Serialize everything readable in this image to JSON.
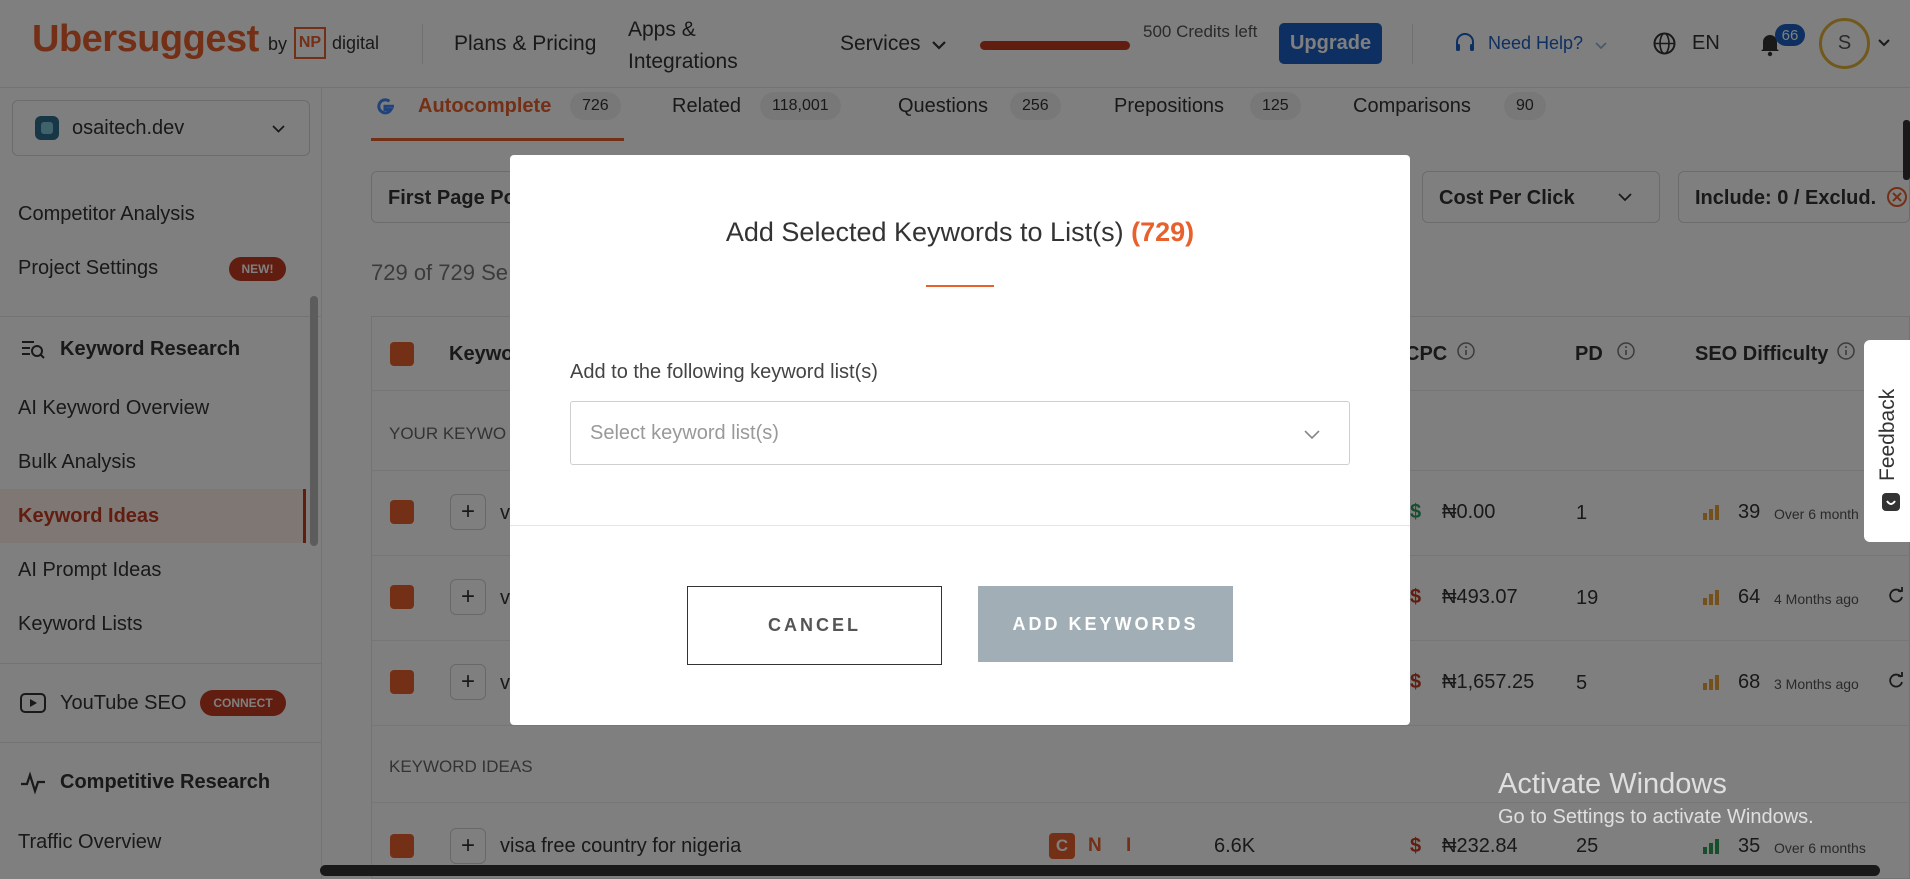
{
  "header": {
    "logo": "Ubersuggest",
    "logo_by": "by",
    "np": "NP",
    "digital": "digital",
    "plans": "Plans & Pricing",
    "apps": "Apps & Integrations",
    "services": "Services",
    "credits": "500 Credits left",
    "upgrade": "Upgrade",
    "help": "Need Help?",
    "lang": "EN",
    "notifications": "66",
    "avatar": "S"
  },
  "sidebar": {
    "project": "osaitech.dev",
    "competitor_analysis": "Competitor Analysis",
    "project_settings": "Project Settings",
    "new_badge": "NEW!",
    "keyword_research": "Keyword Research",
    "ai_keyword_overview": "AI Keyword Overview",
    "bulk_analysis": "Bulk Analysis",
    "keyword_ideas": "Keyword Ideas",
    "ai_prompt_ideas": "AI Prompt Ideas",
    "keyword_lists": "Keyword Lists",
    "youtube_seo": "YouTube SEO",
    "connect_badge": "CONNECT",
    "competitive_research": "Competitive Research",
    "traffic_overview": "Traffic Overview"
  },
  "tabs": [
    {
      "label": "Autocomplete",
      "count": "726"
    },
    {
      "label": "Related",
      "count": "118,001"
    },
    {
      "label": "Questions",
      "count": "256"
    },
    {
      "label": "Prepositions",
      "count": "125"
    },
    {
      "label": "Comparisons",
      "count": "90"
    }
  ],
  "filters": {
    "first_page": "First Page Po",
    "cpc": "Cost Per Click",
    "include": "Include: 0 / Exclud."
  },
  "results_count": "729 of 729 Se",
  "table": {
    "col_keyword": "Keywo",
    "col_cpc": "CPC",
    "col_pd": "PD",
    "col_seo": "SEO Difficulty",
    "your_keywords": "YOUR KEYWO",
    "keyword_ideas": "KEYWORD IDEAS",
    "rows": [
      {
        "kw": "v",
        "cpc": "₦0.00",
        "pd": "1",
        "sd": "39",
        "updated": "Over 6 month"
      },
      {
        "kw": "v",
        "cpc": "₦493.07",
        "pd": "19",
        "sd": "64",
        "updated": "4 Months ago"
      },
      {
        "kw": "v",
        "cpc": "₦1,657.25",
        "pd": "5",
        "sd": "68",
        "updated": "3 Months ago"
      }
    ],
    "idea_row": {
      "kw": "visa free country for nigeria",
      "c": "C",
      "n": "N",
      "i": "I",
      "volume": "6.6K",
      "cpc": "₦232.84",
      "pd": "25",
      "sd": "35",
      "updated": "Over 6 months"
    }
  },
  "modal": {
    "title": "Add Selected Keywords to List(s)",
    "count": "(729)",
    "label": "Add to the following keyword list(s)",
    "placeholder": "Select keyword list(s)",
    "cancel": "CANCEL",
    "add": "ADD KEYWORDS"
  },
  "feedback": "Feedback",
  "watermark": {
    "line1": "Activate Windows",
    "line2": "Go to Settings to activate Windows."
  },
  "colors": {
    "brand": "#e8602c",
    "upgrade": "#1c5fc4",
    "badge": "#c33a1e"
  }
}
